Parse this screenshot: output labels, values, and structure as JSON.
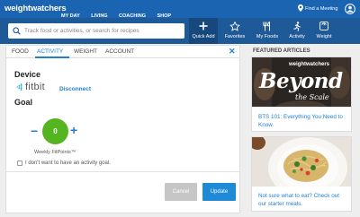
{
  "brand": {
    "logo_text": "weightwatchers"
  },
  "topnav": {
    "links": [
      "MY DAY",
      "LIVING",
      "COACHING",
      "SHOP"
    ],
    "find_meeting": "Find a Meeting"
  },
  "search": {
    "placeholder": "Track food or activities, or search for recipes",
    "value": ""
  },
  "tools": [
    {
      "label": "Quick Add",
      "icon": "plus-icon"
    },
    {
      "label": "Favorites",
      "icon": "star-icon"
    },
    {
      "label": "My Foods",
      "icon": "utensils-icon"
    },
    {
      "label": "Activity",
      "icon": "activity-icon"
    },
    {
      "label": "Weight",
      "icon": "scale-icon"
    }
  ],
  "panel": {
    "tabs": [
      "FOOD",
      "ACTIVITY",
      "WEIGHT",
      "ACCOUNT"
    ],
    "active_tab": "ACTIVITY",
    "close_glyph": "✕",
    "device_heading": "Device",
    "device_name": "fitbit",
    "disconnect_label": "Disconnect",
    "goal_heading": "Goal",
    "goal_value": "0",
    "goal_minus": "−",
    "goal_plus": "+",
    "goal_unit_label": "Weekly FitPoints™",
    "no_goal_label": "I don't want to have an activity goal.",
    "no_goal_checked": false,
    "cancel_label": "Cancel",
    "update_label": "Update"
  },
  "articles": {
    "heading": "FEATURED ARTICLES",
    "items": [
      {
        "title": "BTS 101: Everything You Need to Know.",
        "image_text_top": "weightwatchers",
        "image_text_main": "Beyond",
        "image_text_sub": "the Scale"
      },
      {
        "title": "Not sure what to eat? Check out our starter meals."
      }
    ]
  },
  "colors": {
    "topnav": "#1b64b1",
    "subnav": "#1f5a98",
    "accent": "#1f7fd0",
    "goal_green": "#55b520",
    "update_button": "#1f8ad6",
    "cancel_button": "#c6c6c6"
  }
}
